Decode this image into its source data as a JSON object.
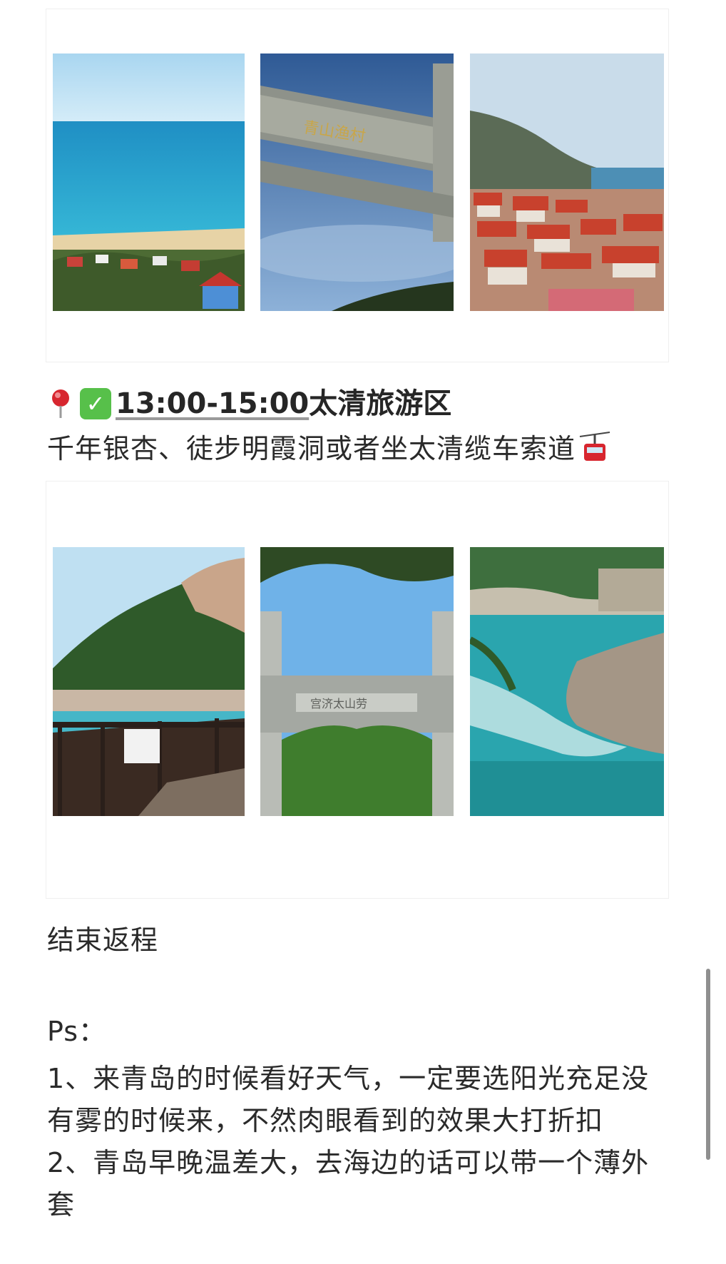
{
  "section": {
    "time": "13:00-15:00",
    "place": "太清旅游区",
    "description": "千年银杏、徒步明霞洞或者坐太清缆车索道"
  },
  "end_text": "结束返程",
  "ps": {
    "label": "Ps：",
    "lines": [
      "1、来青岛的时候看好天气，一定要选阳光充足没",
      "有雾的时候来，不然肉眼看到的效果大打折扣",
      "2、青岛早晚温差大，去海边的话可以带一个薄外",
      "套"
    ]
  },
  "icons": {
    "pin": "round-pushpin-icon",
    "check": "check-mark-button-icon",
    "cablecar": "aerial-tramway-icon"
  },
  "colors": {
    "text": "#262626",
    "check_green": "#57c04a",
    "pin_red": "#d7262f"
  }
}
